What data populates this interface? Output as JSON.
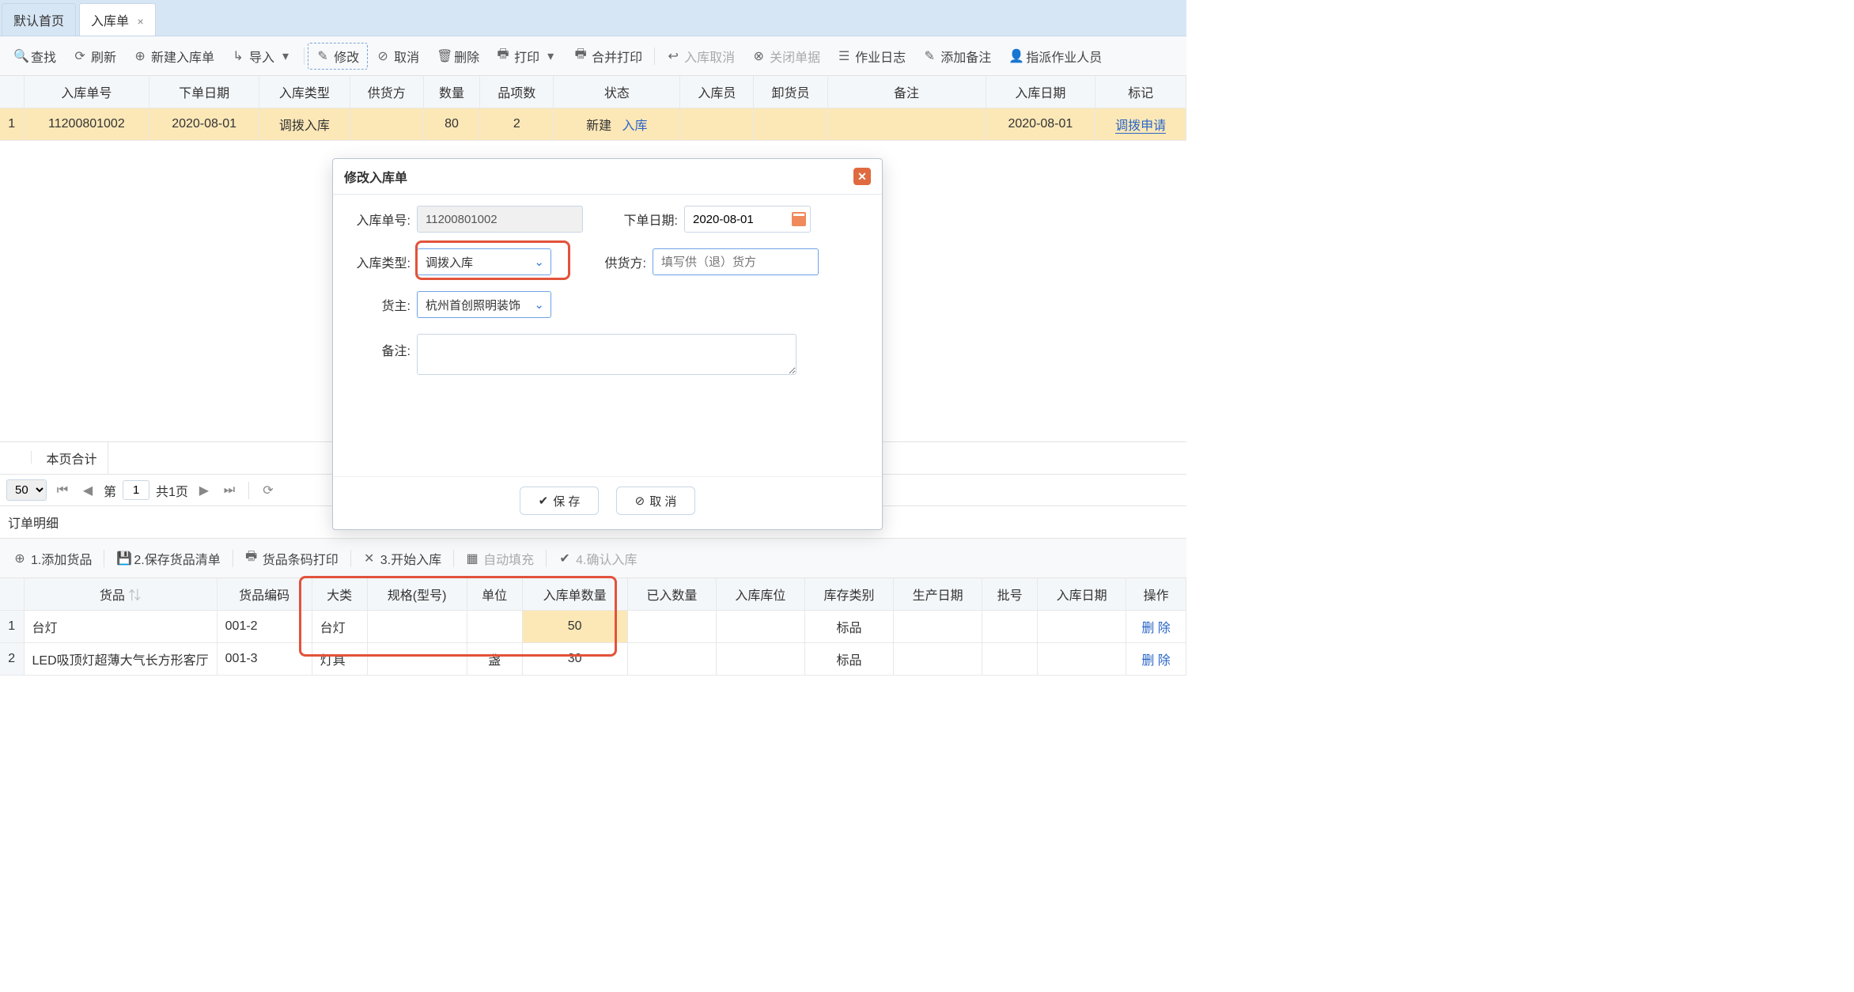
{
  "tabs": {
    "home": "默认首页",
    "current": "入库单"
  },
  "toolbar": {
    "find": "查找",
    "refresh": "刷新",
    "new": "新建入库单",
    "import": "导入",
    "edit": "修改",
    "cancel": "取消",
    "delete": "删除",
    "print": "打印",
    "mergePrint": "合并打印",
    "inCancel": "入库取消",
    "close": "关闭单据",
    "log": "作业日志",
    "remark": "添加备注",
    "assign": "指派作业人员"
  },
  "cols": {
    "no": "入库单号",
    "orderDate": "下单日期",
    "type": "入库类型",
    "supplier": "供货方",
    "qty": "数量",
    "sku": "品项数",
    "status": "状态",
    "inUser": "入库员",
    "unload": "卸货员",
    "remark": "备注",
    "inDate": "入库日期",
    "mark": "标记"
  },
  "row": {
    "idx": "1",
    "no": "11200801002",
    "orderDate": "2020-08-01",
    "type": "调拨入库",
    "qty": "80",
    "sku": "2",
    "statusText": "新建",
    "statusLink": "入库",
    "inDate": "2020-08-01",
    "mark": "调拨申请"
  },
  "page": {
    "sumLabel": "本页合计",
    "size": "50",
    "cur": "1",
    "total": "共1页",
    "pre": "第"
  },
  "detail": {
    "title": "订单明细",
    "tb": {
      "add": "1.添加货品",
      "save": "2.保存货品清单",
      "barcode": "货品条码打印",
      "start": "3.开始入库",
      "autofill": "自动填充",
      "confirm": "4.确认入库"
    },
    "cols": {
      "goods": "货品",
      "code": "货品编码",
      "cat": "大类",
      "spec": "规格(型号)",
      "unit": "单位",
      "inQty": "入库单数量",
      "doneQty": "已入数量",
      "loc": "入库库位",
      "stockType": "库存类别",
      "prodDate": "生产日期",
      "batch": "批号",
      "inDate": "入库日期",
      "op": "操作"
    },
    "rows": [
      {
        "idx": "1",
        "goods": "台灯",
        "code": "001-2",
        "cat": "台灯",
        "spec": "",
        "unit": "",
        "inQty": "50",
        "stockType": "标品",
        "op": "删 除"
      },
      {
        "idx": "2",
        "goods": "LED吸顶灯超薄大气长方形客厅",
        "code": "001-3",
        "cat": "灯具",
        "spec": "",
        "unit": "盏",
        "inQty": "30",
        "stockType": "标品",
        "op": "删 除"
      }
    ]
  },
  "dialog": {
    "title": "修改入库单",
    "noLabel": "入库单号:",
    "no": "11200801002",
    "dateLabel": "下单日期:",
    "date": "2020-08-01",
    "typeLabel": "入库类型:",
    "type": "调拨入库",
    "supLabel": "供货方:",
    "supPh": "填写供（退）货方",
    "ownerLabel": "货主:",
    "owner": "杭州首创照明装饰",
    "remarkLabel": "备注:",
    "save": "保 存",
    "cancel": "取 消"
  }
}
